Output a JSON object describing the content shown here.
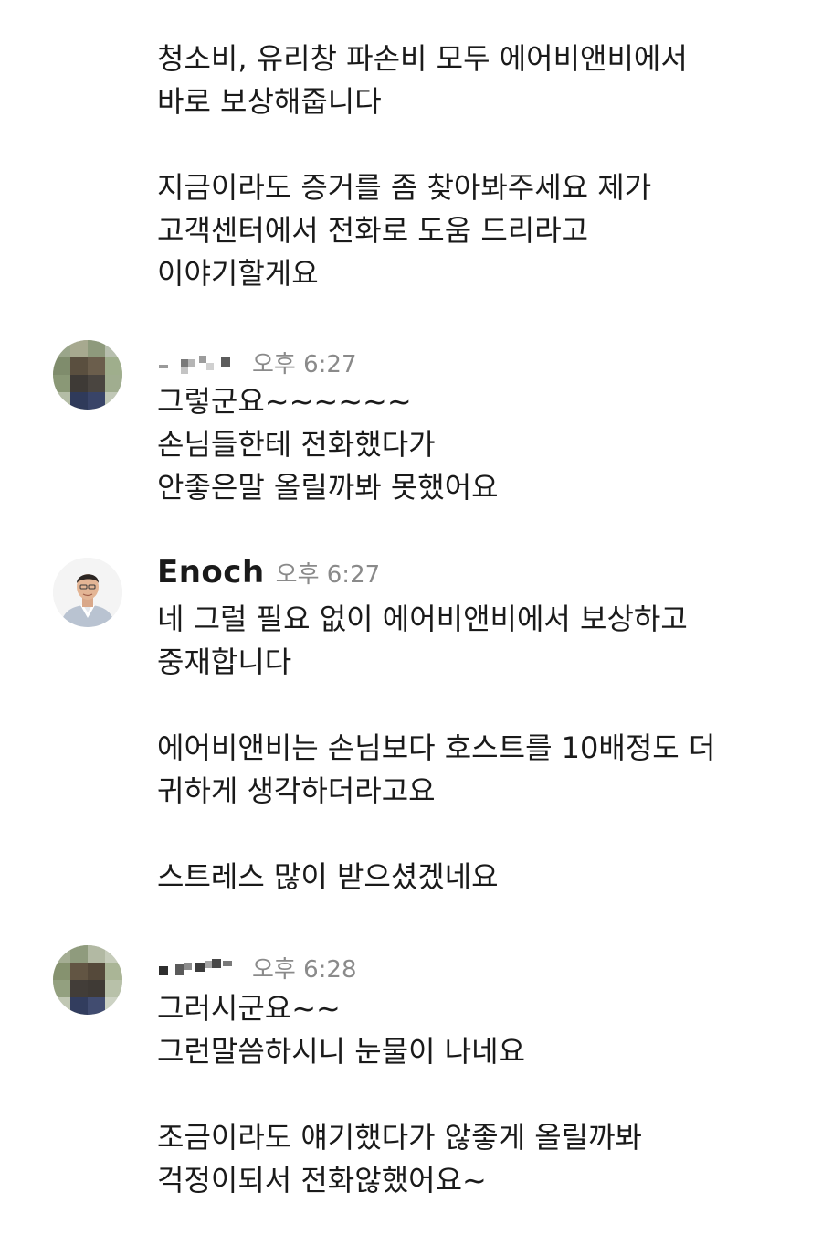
{
  "messages": [
    {
      "sender": "",
      "time": "",
      "paragraphs": [
        [
          "청소비, 유리창 파손비 모두 에어비앤비에서",
          "바로 보상해줍니다"
        ],
        [
          "지금이라도 증거를 좀 찾아봐주세요 제가",
          "고객센터에서 전화로 도움 드리라고",
          "이야기할게요"
        ]
      ]
    },
    {
      "sender": "",
      "time": "오후 6:27",
      "paragraphs": [
        [
          "그렇군요~~~~~~",
          "손님들한테 전화했다가",
          "안좋은말 올릴까봐 못했어요"
        ]
      ]
    },
    {
      "sender": "Enoch",
      "time": "오후 6:27",
      "paragraphs": [
        [
          "네 그럴 필요 없이 에어비앤비에서 보상하고",
          "중재합니다"
        ],
        [
          "에어비앤비는 손님보다 호스트를 10배정도 더",
          "귀하게 생각하더라고요"
        ],
        [
          "스트레스 많이 받으셨겠네요"
        ]
      ]
    },
    {
      "sender": "",
      "time": "오후 6:28",
      "paragraphs": [
        [
          "그러시군요~~",
          "그런말씀하시니 눈물이 나네요"
        ],
        [
          "조금이라도 얘기했다가 않좋게 올릴까봐",
          "걱정이되서 전화않했어요~"
        ]
      ]
    }
  ]
}
